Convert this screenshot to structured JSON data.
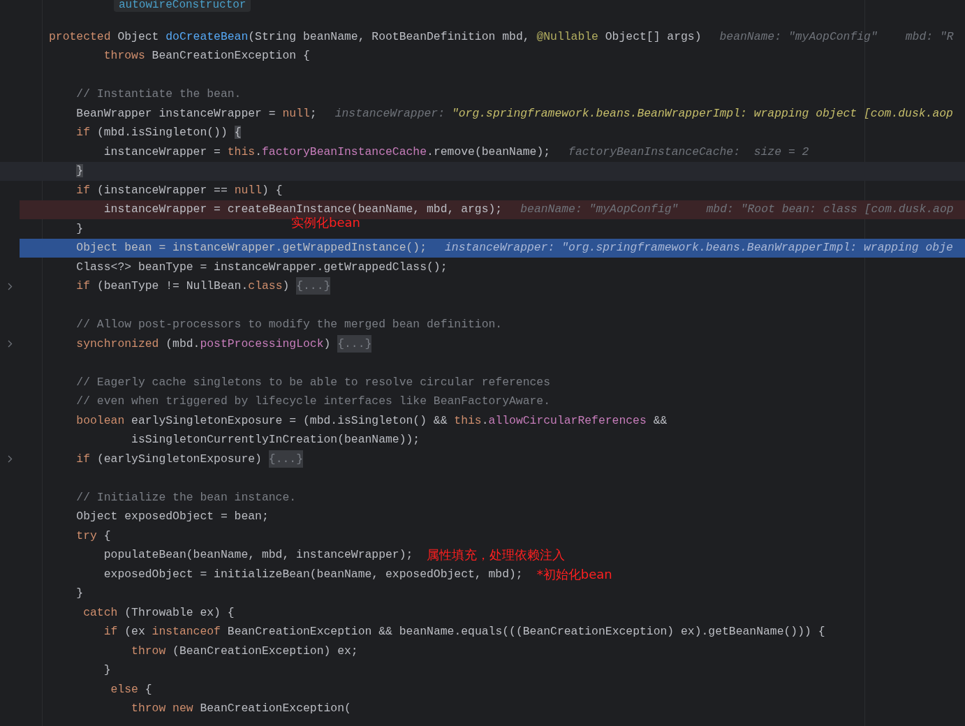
{
  "tooltip": {
    "text": "autowireConstructor"
  },
  "lines": [
    {
      "kind": "normal",
      "folded": false,
      "tokens": [
        {
          "kind": "kw",
          "text": "protected "
        },
        {
          "kind": "p",
          "text": "Object "
        },
        {
          "kind": "fn",
          "text": "doCreateBean"
        },
        {
          "kind": "p",
          "text": "(String beanName, RootBeanDefinition mbd, "
        },
        {
          "kind": "ann",
          "text": "@Nullable"
        },
        {
          "kind": "p",
          "text": " Object[] args)"
        }
      ],
      "hints": [
        {
          "name": "beanName:",
          "value": "\"myAopConfig\"",
          "changed": false
        },
        {
          "name": "mbd:",
          "value": "\"R",
          "changed": false
        }
      ]
    },
    {
      "kind": "normal",
      "folded": false,
      "tokens": [
        {
          "kind": "kw",
          "text": "        throws "
        },
        {
          "kind": "p",
          "text": "BeanCreationException {"
        }
      ]
    },
    {
      "kind": "normal",
      "folded": false
    },
    {
      "kind": "normal",
      "folded": false,
      "tokens": [
        {
          "kind": "cm",
          "text": "    // Instantiate the bean."
        }
      ]
    },
    {
      "kind": "normal",
      "folded": false,
      "tokens": [
        {
          "kind": "p",
          "text": "    BeanWrapper instanceWrapper = "
        },
        {
          "kind": "kw",
          "text": "null"
        },
        {
          "kind": "p",
          "text": ";"
        }
      ],
      "hints": [
        {
          "name": "instanceWrapper:",
          "value": "\"org.springframework.beans.BeanWrapperImpl: wrapping object [com.dusk.aop",
          "changed": true
        }
      ]
    },
    {
      "kind": "normal",
      "folded": false,
      "tokens": [
        {
          "kind": "kw",
          "text": "    if"
        },
        {
          "kind": "p",
          "text": " (mbd.isSingleton()) "
        },
        {
          "kind": "match",
          "text": "{"
        }
      ]
    },
    {
      "kind": "normal",
      "folded": false,
      "tokens": [
        {
          "kind": "p",
          "text": "        instanceWrapper = "
        },
        {
          "kind": "kw",
          "text": "this"
        },
        {
          "kind": "p",
          "text": "."
        },
        {
          "kind": "fld",
          "text": "factoryBeanInstanceCache"
        },
        {
          "kind": "p",
          "text": ".remove(beanName);"
        }
      ],
      "hints": [
        {
          "name": "factoryBeanInstanceCache:",
          "value": " size = 2",
          "changed": false
        }
      ]
    },
    {
      "kind": "caret",
      "folded": false,
      "tokens": [
        {
          "kind": "match",
          "text": "    }"
        }
      ]
    },
    {
      "kind": "normal",
      "folded": false,
      "tokens": [
        {
          "kind": "kw",
          "text": "    if"
        },
        {
          "kind": "p",
          "text": " (instanceWrapper == "
        },
        {
          "kind": "kw",
          "text": "null"
        },
        {
          "kind": "p",
          "text": ") {"
        }
      ]
    },
    {
      "kind": "breakpoint",
      "folded": false,
      "tokens": [
        {
          "kind": "p",
          "text": "        instanceWrapper = createBeanInstance(beanName, mbd, args);"
        }
      ],
      "hints": [
        {
          "name": "beanName:",
          "value": "\"myAopConfig\"",
          "changed": false
        },
        {
          "name": "mbd:",
          "value": "\"Root bean: class [com.dusk.aop",
          "changed": false
        }
      ]
    },
    {
      "kind": "normal",
      "folded": false,
      "tokens": [
        {
          "kind": "p",
          "text": "    }"
        }
      ],
      "note": {
        "kind": "above",
        "text": "实例化bean"
      }
    },
    {
      "kind": "execution",
      "folded": false,
      "tokens": [
        {
          "kind": "p",
          "text": "    Object bean = instanceWrapper.getWrappedInstance();"
        }
      ],
      "hints": [
        {
          "name": "instanceWrapper:",
          "value": "\"org.springframework.beans.BeanWrapperImpl: wrapping obje",
          "changed": false
        }
      ]
    },
    {
      "kind": "normal",
      "folded": false,
      "tokens": [
        {
          "kind": "p",
          "text": "    Class<?> beanType = instanceWrapper.getWrappedClass();"
        }
      ]
    },
    {
      "kind": "normal",
      "folded": true,
      "tokens": [
        {
          "kind": "kw",
          "text": "    if"
        },
        {
          "kind": "p",
          "text": " (beanType != NullBean."
        },
        {
          "kind": "kw",
          "text": "class"
        },
        {
          "kind": "p",
          "text": ") "
        },
        {
          "kind": "fold",
          "text": "{...}"
        }
      ]
    },
    {
      "kind": "normal",
      "folded": false
    },
    {
      "kind": "normal",
      "folded": false,
      "tokens": [
        {
          "kind": "cm",
          "text": "    // Allow post-processors to modify the merged bean definition."
        }
      ]
    },
    {
      "kind": "normal",
      "folded": true,
      "tokens": [
        {
          "kind": "kw",
          "text": "    synchronized"
        },
        {
          "kind": "p",
          "text": " (mbd."
        },
        {
          "kind": "fld",
          "text": "postProcessingLock"
        },
        {
          "kind": "p",
          "text": ") "
        },
        {
          "kind": "fold",
          "text": "{...}"
        }
      ]
    },
    {
      "kind": "normal",
      "folded": false
    },
    {
      "kind": "normal",
      "folded": false,
      "tokens": [
        {
          "kind": "cm",
          "text": "    // Eagerly cache singletons to be able to resolve circular references"
        }
      ]
    },
    {
      "kind": "normal",
      "folded": false,
      "tokens": [
        {
          "kind": "cm",
          "text": "    // even when triggered by lifecycle interfaces like BeanFactoryAware."
        }
      ]
    },
    {
      "kind": "normal",
      "folded": false,
      "tokens": [
        {
          "kind": "kw",
          "text": "    boolean"
        },
        {
          "kind": "p",
          "text": " earlySingletonExposure = (mbd.isSingleton() && "
        },
        {
          "kind": "kw",
          "text": "this"
        },
        {
          "kind": "p",
          "text": "."
        },
        {
          "kind": "fld",
          "text": "allowCircularReferences"
        },
        {
          "kind": "p",
          "text": " &&"
        }
      ]
    },
    {
      "kind": "normal",
      "folded": false,
      "tokens": [
        {
          "kind": "p",
          "text": "            isSingletonCurrentlyInCreation(beanName));"
        }
      ]
    },
    {
      "kind": "normal",
      "folded": true,
      "tokens": [
        {
          "kind": "kw",
          "text": "    if"
        },
        {
          "kind": "p",
          "text": " (earlySingletonExposure) "
        },
        {
          "kind": "fold",
          "text": "{...}"
        }
      ]
    },
    {
      "kind": "normal",
      "folded": false
    },
    {
      "kind": "normal",
      "folded": false,
      "tokens": [
        {
          "kind": "cm",
          "text": "    // Initialize the bean instance."
        }
      ]
    },
    {
      "kind": "normal",
      "folded": false,
      "tokens": [
        {
          "kind": "p",
          "text": "    Object exposedObject = bean;"
        }
      ]
    },
    {
      "kind": "normal",
      "folded": false,
      "tokens": [
        {
          "kind": "kw",
          "text": "    try"
        },
        {
          "kind": "p",
          "text": " {"
        }
      ]
    },
    {
      "kind": "normal",
      "folded": false,
      "tokens": [
        {
          "kind": "p",
          "text": "        populateBean(beanName, mbd, instanceWrapper);"
        }
      ],
      "note": {
        "kind": "inline",
        "text": "属性填充，处理依赖注入"
      }
    },
    {
      "kind": "normal",
      "folded": false,
      "tokens": [
        {
          "kind": "p",
          "text": "        exposedObject = initializeBean(beanName, exposedObject, mbd);"
        }
      ],
      "note": {
        "kind": "inline",
        "text": "*初始化bean"
      }
    },
    {
      "kind": "normal",
      "folded": false,
      "tokens": [
        {
          "kind": "p",
          "text": "    }"
        }
      ]
    },
    {
      "kind": "normal",
      "folded": false,
      "tokens": [
        {
          "kind": "kw",
          "text": "     catch"
        },
        {
          "kind": "p",
          "text": " (Throwable ex) {"
        }
      ]
    },
    {
      "kind": "normal",
      "folded": false,
      "tokens": [
        {
          "kind": "kw",
          "text": "        if"
        },
        {
          "kind": "p",
          "text": " (ex "
        },
        {
          "kind": "kw",
          "text": "instanceof"
        },
        {
          "kind": "p",
          "text": " BeanCreationException && beanName.equals(((BeanCreationException) ex).getBeanName())) {"
        }
      ]
    },
    {
      "kind": "normal",
      "folded": false,
      "tokens": [
        {
          "kind": "kw",
          "text": "            throw"
        },
        {
          "kind": "p",
          "text": " (BeanCreationException) ex;"
        }
      ]
    },
    {
      "kind": "normal",
      "folded": false,
      "tokens": [
        {
          "kind": "p",
          "text": "        }"
        }
      ]
    },
    {
      "kind": "normal",
      "folded": false,
      "tokens": [
        {
          "kind": "kw",
          "text": "         else"
        },
        {
          "kind": "p",
          "text": " {"
        }
      ]
    },
    {
      "kind": "normal",
      "folded": false,
      "tokens": [
        {
          "kind": "kw",
          "text": "            throw new"
        },
        {
          "kind": "p",
          "text": " BeanCreationException("
        }
      ]
    }
  ]
}
